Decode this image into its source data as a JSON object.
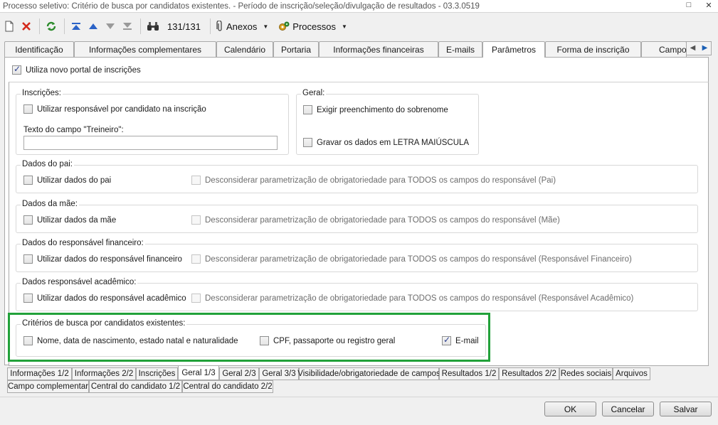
{
  "window": {
    "title": "Processo seletivo: Critério de busca por candidatos existentes. - Período de inscrição/seleção/divulgação de resultados - 03.3.0519",
    "btn_restore": "□",
    "btn_close": "✕"
  },
  "toolbar": {
    "record_counter": "131/131",
    "anexos_label": "Anexos",
    "processos_label": "Processos",
    "icons": [
      "new-document-icon",
      "delete-icon",
      "refresh-icon",
      "first-record-icon",
      "previous-record-icon",
      "next-record-icon",
      "last-record-icon",
      "binoculars-icon",
      "paperclip-icon",
      "gears-icon"
    ]
  },
  "tabs_top": {
    "items": [
      {
        "label": "Identificação"
      },
      {
        "label": "Informações complementares"
      },
      {
        "label": "Calendário"
      },
      {
        "label": "Portaria"
      },
      {
        "label": "Informações financeiras"
      },
      {
        "label": "E-mails"
      },
      {
        "label": "Parâmetros"
      },
      {
        "label": "Forma de inscrição"
      },
      {
        "label": "Campo"
      }
    ],
    "active": "Parâmetros",
    "scroll_left": "◀",
    "scroll_right": "▶"
  },
  "main": {
    "novo_portal": {
      "label": "Utiliza novo portal de inscrições",
      "checked": true
    },
    "inscricoes": {
      "legend": "Inscrições:",
      "responsavel": {
        "label": "Utilizar responsável por candidato na inscrição",
        "checked": false
      },
      "treineiro_label": "Texto do campo \"Treineiro\":",
      "treineiro_value": ""
    },
    "geral": {
      "legend": "Geral:",
      "sobrenome": {
        "label": "Exigir preenchimento do sobrenome",
        "checked": false
      },
      "maiuscula": {
        "label": "Gravar os dados em LETRA MAIÚSCULA",
        "checked": false
      }
    },
    "pai": {
      "legend": "Dados do pai:",
      "usar": {
        "label": "Utilizar dados do pai",
        "checked": false
      },
      "desconsiderar": {
        "label": "Desconsiderar parametrização de obrigatoriedade para TODOS os campos do responsável (Pai)",
        "checked": false
      }
    },
    "mae": {
      "legend": "Dados da mãe:",
      "usar": {
        "label": "Utilizar dados da mãe",
        "checked": false
      },
      "desconsiderar": {
        "label": "Desconsiderar parametrização de obrigatoriedade para TODOS os campos do responsável (Mãe)",
        "checked": false
      }
    },
    "financeiro": {
      "legend": "Dados do responsável financeiro:",
      "usar": {
        "label": "Utilizar dados do responsável financeiro",
        "checked": false
      },
      "desconsiderar": {
        "label": "Desconsiderar parametrização de obrigatoriedade para TODOS os campos do responsável (Responsável Financeiro)",
        "checked": false
      }
    },
    "academico": {
      "legend": "Dados responsável acadêmico:",
      "usar": {
        "label": "Utilizar dados do responsável acadêmico",
        "checked": false
      },
      "desconsiderar": {
        "label": "Desconsiderar parametrização de obrigatoriedade para TODOS os campos do responsável (Responsável Acadêmico)",
        "checked": false
      }
    },
    "criterios": {
      "legend": "Critérios de busca por candidatos existentes:",
      "nome": {
        "label": "Nome, data de nascimento, estado natal e naturalidade",
        "checked": false
      },
      "cpf": {
        "label": "CPF, passaporte ou registro geral",
        "checked": false
      },
      "email": {
        "label": "E-mail",
        "checked": true
      },
      "highlight_color": "#22a13a"
    }
  },
  "tabs_bottom": {
    "row1": [
      "Informações 1/2",
      "Informações 2/2",
      "Inscrições",
      "Geral 1/3",
      "Geral 2/3",
      "Geral 3/3",
      "Visibilidade/obrigatoriedade de campos",
      "Resultados 1/2",
      "Resultados 2/2",
      "Redes sociais",
      "Arquivos"
    ],
    "row2": [
      "Campo complementar",
      "Central do candidato 1/2",
      "Central do candidato 2/2"
    ],
    "active": "Geral 1/3"
  },
  "footer": {
    "ok_label": "OK",
    "cancel_label": "Cancelar",
    "save_label": "Salvar"
  }
}
